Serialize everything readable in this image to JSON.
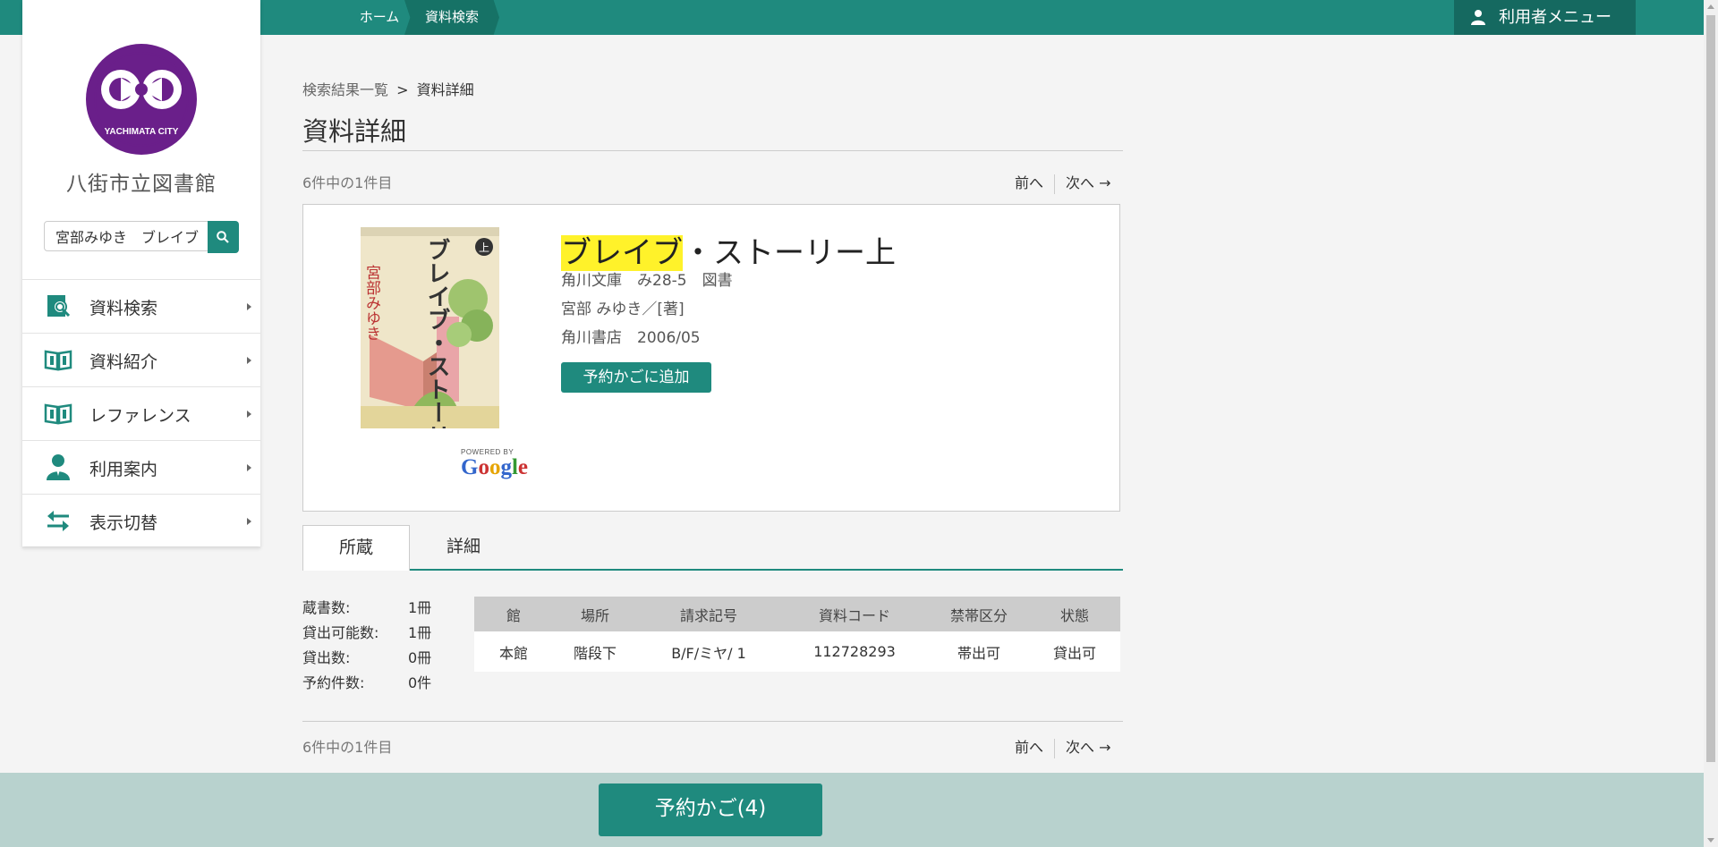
{
  "topbar": {
    "home": "ホーム",
    "search": "資料検索",
    "user_menu": "利用者メニュー"
  },
  "sidebar": {
    "logo_text": "YACHIMATA CITY",
    "library_name": "八街市立図書館",
    "search_value": "宮部みゆき　ブレイブ",
    "items": [
      {
        "label": "資料検索",
        "icon": "search-book-icon"
      },
      {
        "label": "資料紹介",
        "icon": "open-book-icon"
      },
      {
        "label": "レファレンス",
        "icon": "open-book-icon"
      },
      {
        "label": "利用案内",
        "icon": "user-icon"
      },
      {
        "label": "表示切替",
        "icon": "switch-arrows-icon"
      }
    ]
  },
  "breadcrumb": {
    "results": "検索結果一覧",
    "sep": ">",
    "current": "資料詳細"
  },
  "page_title": "資料詳細",
  "pager": {
    "count": "6件中の1件目",
    "prev": "前へ",
    "next": "次へ →"
  },
  "book": {
    "title_highlight": "ブレイブ",
    "title_rest": "・ストーリー上",
    "series": "角川文庫　み28-5　図書",
    "author": "宮部 みゆき／[著]",
    "publisher": "角川書店　2006/05",
    "add_button": "予約かごに追加",
    "cover_title": "ブレイブ・ストーリー",
    "cover_author": "宮部みゆき",
    "cover_vol": "上",
    "powered_by": "POWERED BY",
    "google": "Google"
  },
  "tabs": {
    "holdings": "所蔵",
    "details": "詳細"
  },
  "stats": [
    {
      "label": "蔵書数:",
      "value": "1冊"
    },
    {
      "label": "貸出可能数:",
      "value": "1冊"
    },
    {
      "label": "貸出数:",
      "value": "0冊"
    },
    {
      "label": "予約件数:",
      "value": "0件"
    }
  ],
  "holdings": {
    "headers": [
      "館",
      "場所",
      "請求記号",
      "資料コード",
      "禁帯区分",
      "状態"
    ],
    "rows": [
      [
        "本館",
        "階段下",
        "B/F/ミヤ/ 1",
        "112728293",
        "帯出可",
        "貸出可"
      ]
    ]
  },
  "footer": {
    "cart": "予約かご(4)"
  },
  "colors": {
    "accent": "#1f8a7e",
    "accent_dark": "#156960",
    "highlight": "#fff22a",
    "footer_bg": "#b8d2ce"
  }
}
